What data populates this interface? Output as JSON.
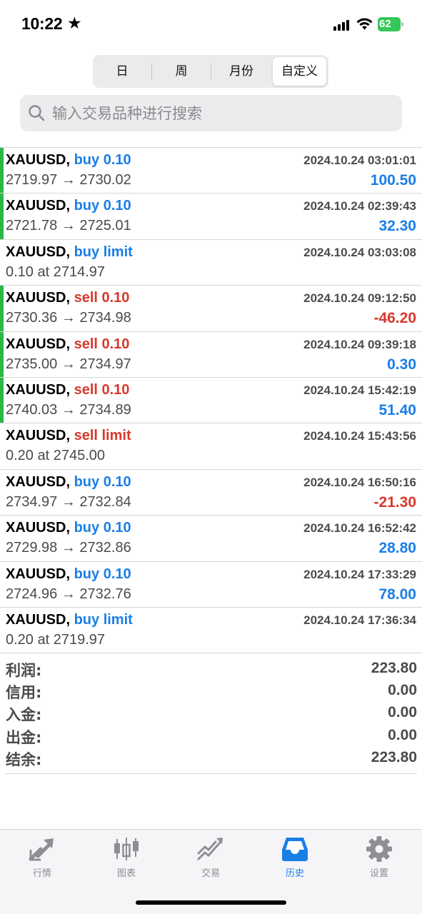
{
  "status_bar": {
    "time": "10:22",
    "battery": "62"
  },
  "period_tabs": [
    {
      "label": "日",
      "active": false
    },
    {
      "label": "周",
      "active": false
    },
    {
      "label": "月份",
      "active": false
    },
    {
      "label": "自定义",
      "active": true
    }
  ],
  "search": {
    "placeholder": "输入交易品种进行搜索"
  },
  "orders": [
    {
      "symbol": "XAUUSD,",
      "side": "buy 0.10",
      "direction": "buy",
      "time": "2024.10.24 03:01:01",
      "price": "2719.97 → 2730.02",
      "profit": "100.50",
      "profit_sign": "pos",
      "filled": true
    },
    {
      "symbol": "XAUUSD,",
      "side": "buy 0.10",
      "direction": "buy",
      "time": "2024.10.24 02:39:43",
      "price": "2721.78 → 2725.01",
      "profit": "32.30",
      "profit_sign": "pos",
      "filled": true
    },
    {
      "symbol": "XAUUSD,",
      "side": "buy limit",
      "direction": "buy",
      "time": "2024.10.24 03:03:08",
      "price": "0.10 at 2714.97",
      "profit": "",
      "profit_sign": "pos",
      "filled": false
    },
    {
      "symbol": "XAUUSD,",
      "side": "sell 0.10",
      "direction": "sell",
      "time": "2024.10.24 09:12:50",
      "price": "2730.36 → 2734.98",
      "profit": "-46.20",
      "profit_sign": "neg",
      "filled": true
    },
    {
      "symbol": "XAUUSD,",
      "side": "sell 0.10",
      "direction": "sell",
      "time": "2024.10.24 09:39:18",
      "price": "2735.00 → 2734.97",
      "profit": "0.30",
      "profit_sign": "pos",
      "filled": true
    },
    {
      "symbol": "XAUUSD,",
      "side": "sell 0.10",
      "direction": "sell",
      "time": "2024.10.24 15:42:19",
      "price": "2740.03 → 2734.89",
      "profit": "51.40",
      "profit_sign": "pos",
      "filled": true
    },
    {
      "symbol": "XAUUSD,",
      "side": "sell limit",
      "direction": "sell",
      "time": "2024.10.24 15:43:56",
      "price": "0.20 at 2745.00",
      "profit": "",
      "profit_sign": "pos",
      "filled": false
    },
    {
      "symbol": "XAUUSD,",
      "side": "buy 0.10",
      "direction": "buy",
      "time": "2024.10.24 16:50:16",
      "price": "2734.97 → 2732.84",
      "profit": "-21.30",
      "profit_sign": "neg",
      "filled": false
    },
    {
      "symbol": "XAUUSD,",
      "side": "buy 0.10",
      "direction": "buy",
      "time": "2024.10.24 16:52:42",
      "price": "2729.98 → 2732.86",
      "profit": "28.80",
      "profit_sign": "pos",
      "filled": false
    },
    {
      "symbol": "XAUUSD,",
      "side": "buy 0.10",
      "direction": "buy",
      "time": "2024.10.24 17:33:29",
      "price": "2724.96 → 2732.76",
      "profit": "78.00",
      "profit_sign": "pos",
      "filled": false
    },
    {
      "symbol": "XAUUSD,",
      "side": "buy limit",
      "direction": "buy",
      "time": "2024.10.24 17:36:34",
      "price": "0.20 at 2719.97",
      "profit": "",
      "profit_sign": "pos",
      "filled": false
    }
  ],
  "summary": [
    {
      "label": "利润:",
      "value": "223.80"
    },
    {
      "label": "信用:",
      "value": "0.00"
    },
    {
      "label": "入金:",
      "value": "0.00"
    },
    {
      "label": "出金:",
      "value": "0.00"
    },
    {
      "label": "结余:",
      "value": "223.80"
    }
  ],
  "tabbar": [
    {
      "label": "行情",
      "icon": "quotes-icon",
      "active": false
    },
    {
      "label": "图表",
      "icon": "chart-icon",
      "active": false
    },
    {
      "label": "交易",
      "icon": "trade-icon",
      "active": false
    },
    {
      "label": "历史",
      "icon": "history-icon",
      "active": true
    },
    {
      "label": "设置",
      "icon": "settings-icon",
      "active": false
    }
  ],
  "colors": {
    "buy": "#1a7ee8",
    "sell": "#d9382b",
    "filled_bar": "#29b847",
    "active_tab": "#1a7ee8",
    "inactive_tab": "#8e8e93"
  }
}
